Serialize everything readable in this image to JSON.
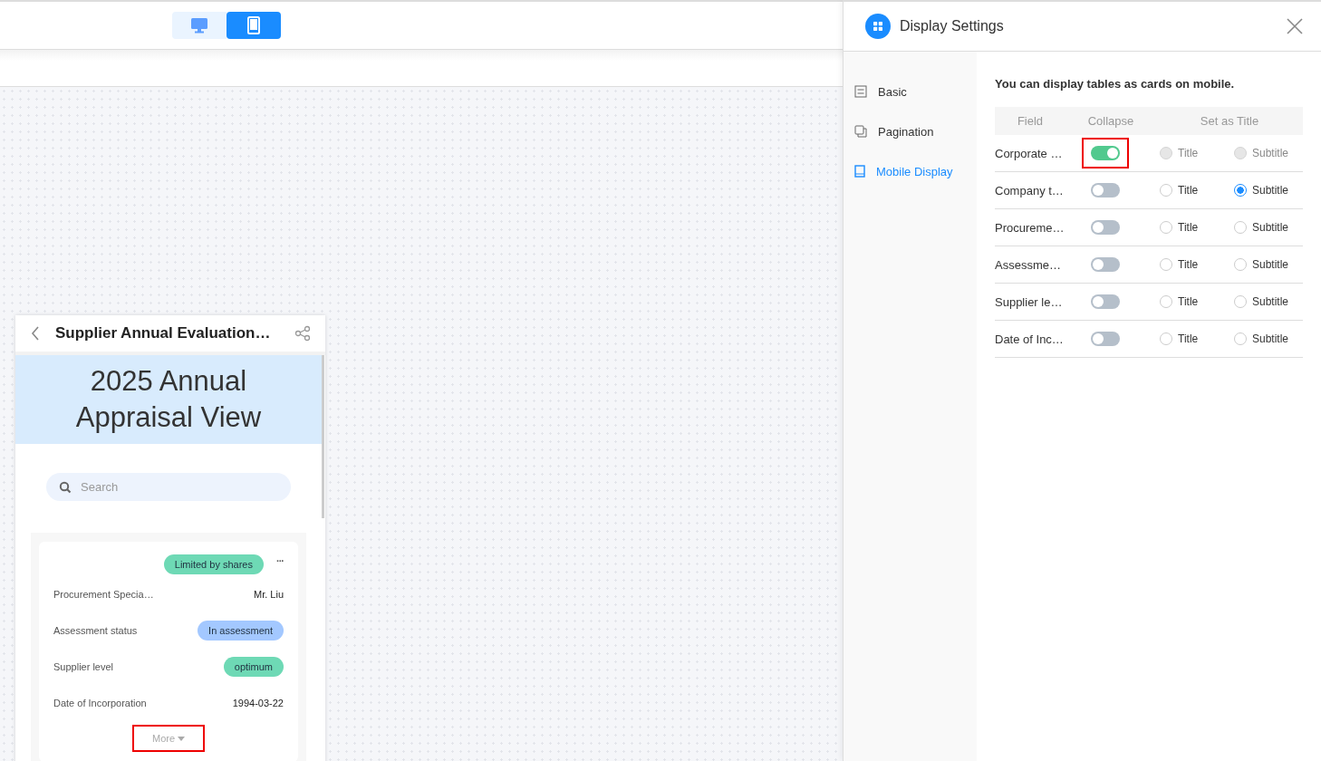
{
  "device_toggle": [
    {
      "kind": "desktop",
      "selected": false
    },
    {
      "kind": "mobile",
      "selected": true
    }
  ],
  "phone": {
    "title": "Supplier Annual Evaluation…",
    "banner": "2025 Annual Appraisal View",
    "search": {
      "placeholder": "Search"
    },
    "card": {
      "tag": "Limited by shares",
      "more_icon": "···",
      "fields": [
        {
          "label": "Procurement Specia…",
          "value": "Mr. Liu",
          "kind": "text"
        },
        {
          "label": "Assessment status",
          "value": "In assessment",
          "kind": "tag",
          "color": "#a3c8ff"
        },
        {
          "label": "Supplier level",
          "value": "optimum",
          "kind": "tag",
          "color": "#6ed9b5"
        },
        {
          "label": "Date of Incorporation",
          "value": "1994-03-22",
          "kind": "text"
        }
      ],
      "more": {
        "label": "More",
        "highlight": true
      }
    }
  },
  "panel": {
    "title": "Display Settings",
    "menu": [
      {
        "label": "Basic",
        "kind": "basic",
        "selected": false
      },
      {
        "label": "Pagination",
        "kind": "pagination",
        "selected": false
      },
      {
        "label": "Mobile Display",
        "kind": "mobile",
        "selected": true
      }
    ],
    "intro": "You can display tables as cards on mobile.",
    "columns": [
      "Field",
      "Collapse",
      "Set as Title"
    ],
    "rows": [
      {
        "field": "Corporate …",
        "collapse": true,
        "highlight": true,
        "disabled": true,
        "title_label": "Title",
        "title_selected": false,
        "subtitle_label": "Subtitle",
        "subtitle_selected": false
      },
      {
        "field": "Company t…",
        "collapse": false,
        "highlight": false,
        "disabled": false,
        "title_label": "Title",
        "title_selected": false,
        "subtitle_label": "Subtitle",
        "subtitle_selected": true
      },
      {
        "field": "Procureme…",
        "collapse": false,
        "highlight": false,
        "disabled": false,
        "title_label": "Title",
        "title_selected": false,
        "subtitle_label": "Subtitle",
        "subtitle_selected": false
      },
      {
        "field": "Assessme…",
        "collapse": false,
        "highlight": false,
        "disabled": false,
        "title_label": "Title",
        "title_selected": false,
        "subtitle_label": "Subtitle",
        "subtitle_selected": false
      },
      {
        "field": "Supplier le…",
        "collapse": false,
        "highlight": false,
        "disabled": false,
        "title_label": "Title",
        "title_selected": false,
        "subtitle_label": "Subtitle",
        "subtitle_selected": false
      },
      {
        "field": "Date of Inc…",
        "collapse": false,
        "highlight": false,
        "disabled": false,
        "title_label": "Title",
        "title_selected": false,
        "subtitle_label": "Subtitle",
        "subtitle_selected": false
      }
    ]
  }
}
